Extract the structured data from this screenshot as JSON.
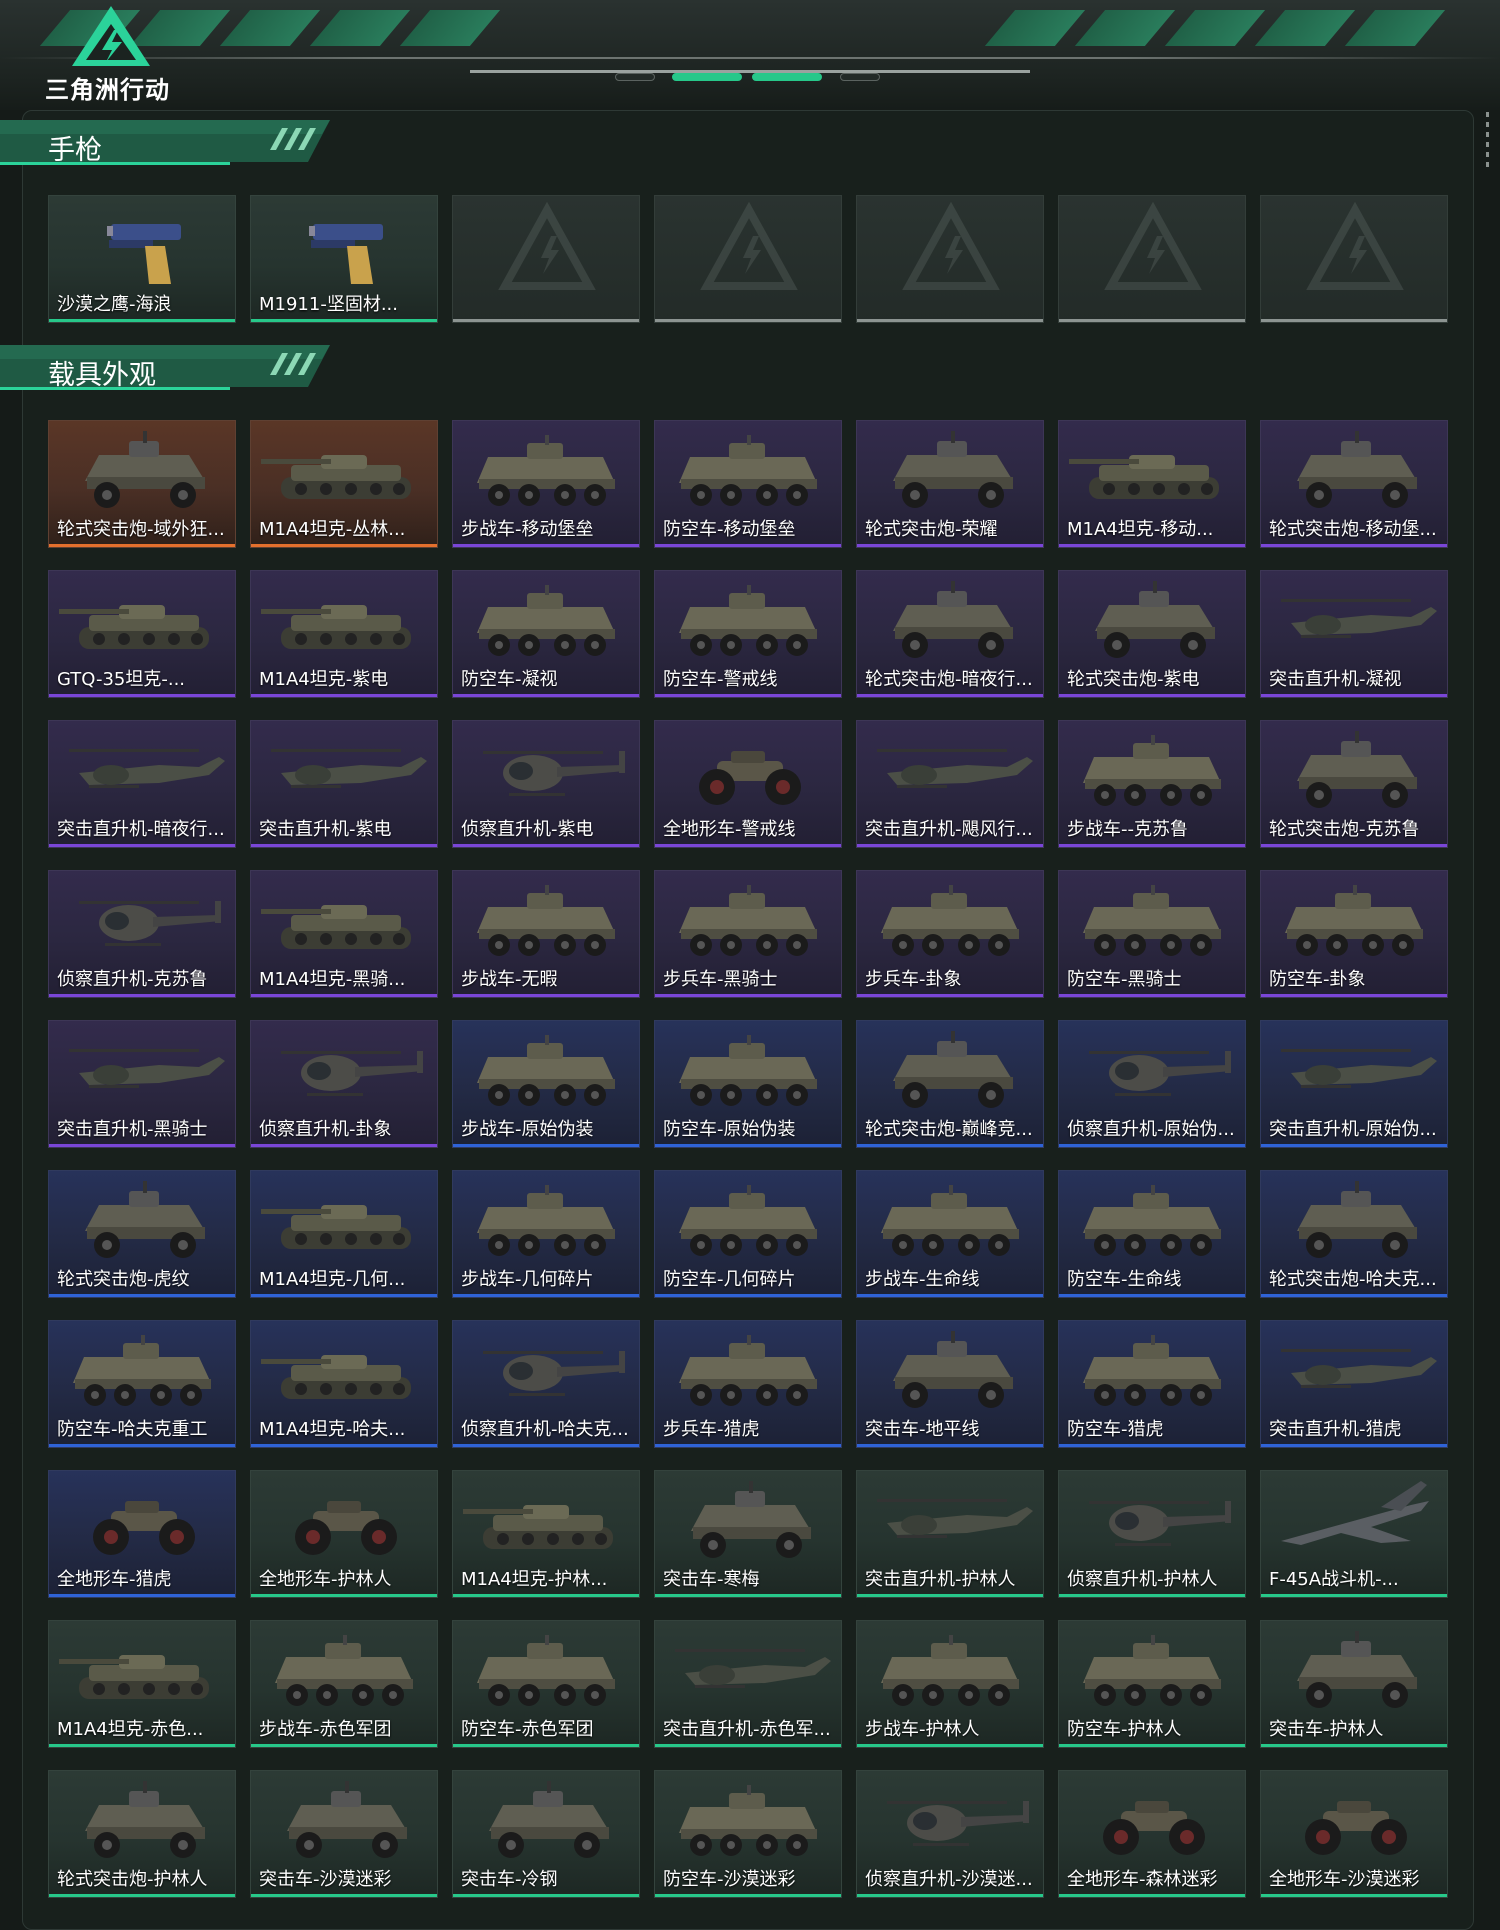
{
  "app": {
    "logo_text": "三角洲行动",
    "logo_icon": "delta-lightning-triangle-icon"
  },
  "colors": {
    "accent": "#27c88a",
    "rarity_orange": "#e4702d",
    "rarity_purple": "#7a46d8",
    "rarity_blue": "#2f63d7",
    "rarity_green": "#27c88a",
    "empty": "#8c9491"
  },
  "sections": [
    {
      "title": "手枪",
      "items": [
        {
          "label": "沙漠之鹰-海浪",
          "rarity": "green",
          "icon": "pistol-icon"
        },
        {
          "label": "M1911-坚固材...",
          "rarity": "green",
          "icon": "pistol-icon"
        },
        {
          "label": "",
          "rarity": "empty",
          "icon": "placeholder-logo-icon"
        },
        {
          "label": "",
          "rarity": "empty",
          "icon": "placeholder-logo-icon"
        },
        {
          "label": "",
          "rarity": "empty",
          "icon": "placeholder-logo-icon"
        },
        {
          "label": "",
          "rarity": "empty",
          "icon": "placeholder-logo-icon"
        },
        {
          "label": "",
          "rarity": "empty",
          "icon": "placeholder-logo-icon"
        }
      ]
    },
    {
      "title": "载具外观",
      "items": [
        {
          "label": "轮式突击炮-域外狂...",
          "rarity": "orange",
          "icon": "armored-car-icon"
        },
        {
          "label": "M1A4坦克-丛林...",
          "rarity": "orange",
          "icon": "tank-icon"
        },
        {
          "label": "步战车-移动堡垒",
          "rarity": "purple",
          "icon": "apc-icon"
        },
        {
          "label": "防空车-移动堡垒",
          "rarity": "purple",
          "icon": "apc-icon"
        },
        {
          "label": "轮式突击炮-荣耀",
          "rarity": "purple",
          "icon": "armored-car-icon"
        },
        {
          "label": "M1A4坦克-移动...",
          "rarity": "purple",
          "icon": "tank-icon"
        },
        {
          "label": "轮式突击炮-移动堡...",
          "rarity": "purple",
          "icon": "armored-car-icon"
        },
        {
          "label": "GTQ-35坦克-...",
          "rarity": "purple",
          "icon": "tank-icon"
        },
        {
          "label": "M1A4坦克-紫电",
          "rarity": "purple",
          "icon": "tank-icon"
        },
        {
          "label": "防空车-凝视",
          "rarity": "purple",
          "icon": "apc-icon"
        },
        {
          "label": "防空车-警戒线",
          "rarity": "purple",
          "icon": "apc-icon"
        },
        {
          "label": "轮式突击炮-暗夜行...",
          "rarity": "purple",
          "icon": "armored-car-icon"
        },
        {
          "label": "轮式突击炮-紫电",
          "rarity": "purple",
          "icon": "armored-car-icon"
        },
        {
          "label": "突击直升机-凝视",
          "rarity": "purple",
          "icon": "attack-helicopter-icon"
        },
        {
          "label": "突击直升机-暗夜行...",
          "rarity": "purple",
          "icon": "attack-helicopter-icon"
        },
        {
          "label": "突击直升机-紫电",
          "rarity": "purple",
          "icon": "attack-helicopter-icon"
        },
        {
          "label": "侦察直升机-紫电",
          "rarity": "purple",
          "icon": "scout-helicopter-icon"
        },
        {
          "label": "全地形车-警戒线",
          "rarity": "purple",
          "icon": "atv-icon"
        },
        {
          "label": "突击直升机-飓风行...",
          "rarity": "purple",
          "icon": "attack-helicopter-icon"
        },
        {
          "label": "步战车--克苏鲁",
          "rarity": "purple",
          "icon": "apc-icon"
        },
        {
          "label": "轮式突击炮-克苏鲁",
          "rarity": "purple",
          "icon": "armored-car-icon"
        },
        {
          "label": "侦察直升机-克苏鲁",
          "rarity": "purple",
          "icon": "scout-helicopter-icon"
        },
        {
          "label": "M1A4坦克-黑骑...",
          "rarity": "purple",
          "icon": "tank-icon"
        },
        {
          "label": "步战车-无暇",
          "rarity": "purple",
          "icon": "apc-icon"
        },
        {
          "label": "步兵车-黑骑士",
          "rarity": "purple",
          "icon": "apc-icon"
        },
        {
          "label": "步兵车-卦象",
          "rarity": "purple",
          "icon": "apc-icon"
        },
        {
          "label": "防空车-黑骑士",
          "rarity": "purple",
          "icon": "apc-icon"
        },
        {
          "label": "防空车-卦象",
          "rarity": "purple",
          "icon": "apc-icon"
        },
        {
          "label": "突击直升机-黑骑士",
          "rarity": "purple",
          "icon": "attack-helicopter-icon"
        },
        {
          "label": "侦察直升机-卦象",
          "rarity": "purple",
          "icon": "scout-helicopter-icon"
        },
        {
          "label": "步战车-原始伪装",
          "rarity": "blue",
          "icon": "apc-icon"
        },
        {
          "label": "防空车-原始伪装",
          "rarity": "blue",
          "icon": "apc-icon"
        },
        {
          "label": "轮式突击炮-巅峰竞...",
          "rarity": "blue",
          "icon": "armored-car-icon"
        },
        {
          "label": "侦察直升机-原始伪...",
          "rarity": "blue",
          "icon": "scout-helicopter-icon"
        },
        {
          "label": "突击直升机-原始伪...",
          "rarity": "blue",
          "icon": "attack-helicopter-icon"
        },
        {
          "label": "轮式突击炮-虎纹",
          "rarity": "blue",
          "icon": "armored-car-icon"
        },
        {
          "label": "M1A4坦克-几何...",
          "rarity": "blue",
          "icon": "tank-icon"
        },
        {
          "label": "步战车-几何碎片",
          "rarity": "blue",
          "icon": "apc-icon"
        },
        {
          "label": "防空车-几何碎片",
          "rarity": "blue",
          "icon": "apc-icon"
        },
        {
          "label": "步战车-生命线",
          "rarity": "blue",
          "icon": "apc-icon"
        },
        {
          "label": "防空车-生命线",
          "rarity": "blue",
          "icon": "apc-icon"
        },
        {
          "label": "轮式突击炮-哈夫克...",
          "rarity": "blue",
          "icon": "armored-car-icon"
        },
        {
          "label": "防空车-哈夫克重工",
          "rarity": "blue",
          "icon": "apc-icon"
        },
        {
          "label": "M1A4坦克-哈夫...",
          "rarity": "blue",
          "icon": "tank-icon"
        },
        {
          "label": "侦察直升机-哈夫克...",
          "rarity": "blue",
          "icon": "scout-helicopter-icon"
        },
        {
          "label": "步兵车-猎虎",
          "rarity": "blue",
          "icon": "apc-icon"
        },
        {
          "label": "突击车-地平线",
          "rarity": "blue",
          "icon": "armored-car-icon"
        },
        {
          "label": "防空车-猎虎",
          "rarity": "blue",
          "icon": "apc-icon"
        },
        {
          "label": "突击直升机-猎虎",
          "rarity": "blue",
          "icon": "attack-helicopter-icon"
        },
        {
          "label": "全地形车-猎虎",
          "rarity": "blue",
          "icon": "atv-icon"
        },
        {
          "label": "全地形车-护林人",
          "rarity": "green",
          "icon": "atv-icon"
        },
        {
          "label": "M1A4坦克-护林...",
          "rarity": "green",
          "icon": "tank-icon"
        },
        {
          "label": "突击车-寒梅",
          "rarity": "green",
          "icon": "armored-car-icon"
        },
        {
          "label": "突击直升机-护林人",
          "rarity": "green",
          "icon": "attack-helicopter-icon"
        },
        {
          "label": "侦察直升机-护林人",
          "rarity": "green",
          "icon": "scout-helicopter-icon"
        },
        {
          "label": "F-45A战斗机-...",
          "rarity": "green",
          "icon": "fighter-jet-icon"
        },
        {
          "label": "M1A4坦克-赤色...",
          "rarity": "green",
          "icon": "tank-icon"
        },
        {
          "label": "步战车-赤色军团",
          "rarity": "green",
          "icon": "apc-icon"
        },
        {
          "label": "防空车-赤色军团",
          "rarity": "green",
          "icon": "apc-icon"
        },
        {
          "label": "突击直升机-赤色军...",
          "rarity": "green",
          "icon": "attack-helicopter-icon"
        },
        {
          "label": "步战车-护林人",
          "rarity": "green",
          "icon": "apc-icon"
        },
        {
          "label": "防空车-护林人",
          "rarity": "green",
          "icon": "apc-icon"
        },
        {
          "label": "突击车-护林人",
          "rarity": "green",
          "icon": "armored-car-icon"
        },
        {
          "label": "轮式突击炮-护林人",
          "rarity": "green",
          "icon": "armored-car-icon"
        },
        {
          "label": "突击车-沙漠迷彩",
          "rarity": "green",
          "icon": "armored-car-icon"
        },
        {
          "label": "突击车-冷钢",
          "rarity": "green",
          "icon": "armored-car-icon"
        },
        {
          "label": "防空车-沙漠迷彩",
          "rarity": "green",
          "icon": "apc-icon"
        },
        {
          "label": "侦察直升机-沙漠迷...",
          "rarity": "green",
          "icon": "scout-helicopter-icon"
        },
        {
          "label": "全地形车-森林迷彩",
          "rarity": "green",
          "icon": "atv-icon"
        },
        {
          "label": "全地形车-沙漠迷彩",
          "rarity": "green",
          "icon": "atv-icon"
        }
      ]
    }
  ]
}
